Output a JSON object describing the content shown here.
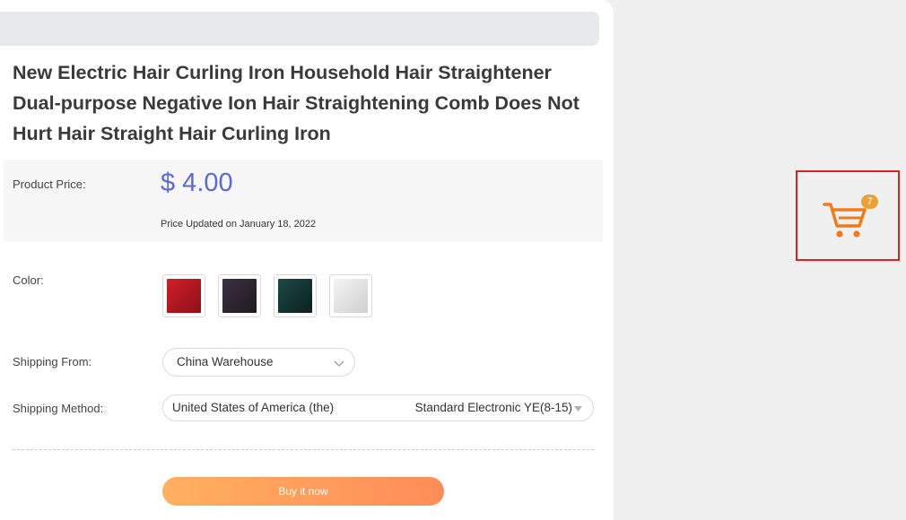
{
  "product": {
    "title": "New Electric Hair Curling Iron Household Hair Straightener Dual-purpose Negative Ion Hair Straightening Comb Does Not Hurt Hair Straight Hair Curling Iron"
  },
  "price": {
    "label": "Product Price:",
    "value": "$ 4.00",
    "updated": "Price Updated on January 18, 2022",
    "color": "#5b6bd3"
  },
  "color_option": {
    "label": "Color:",
    "swatches": [
      {
        "name": "red",
        "color": "#b81a22"
      },
      {
        "name": "dark-purple",
        "color": "#2f2630"
      },
      {
        "name": "dark-teal",
        "color": "#12332f"
      },
      {
        "name": "white",
        "color": "#e6e6e6"
      }
    ]
  },
  "shipping_from": {
    "label": "Shipping From:",
    "value": "China Warehouse"
  },
  "shipping_method": {
    "label": "Shipping Method:",
    "country": "United States of America (the)",
    "method": "Standard Electronic YE(8-15)"
  },
  "buy_button": {
    "label": "Buy it now"
  },
  "cart": {
    "count": "7",
    "icon_color": "#f07a1a",
    "badge_color": "#e9a23b"
  }
}
